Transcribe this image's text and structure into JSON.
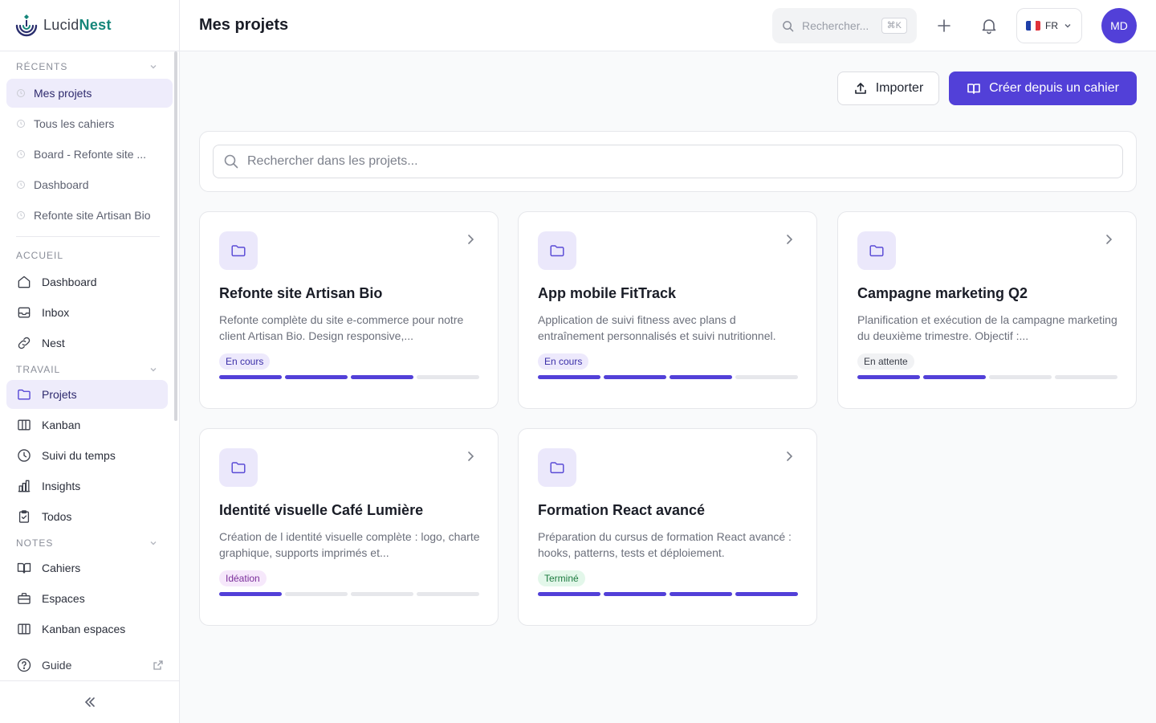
{
  "brand": {
    "name_part1": "Lucid",
    "name_part2": "Nest"
  },
  "header": {
    "title": "Mes projets",
    "search_placeholder": "Rechercher...",
    "search_shortcut": "⌘K",
    "language": "FR",
    "avatar_initials": "MD"
  },
  "sidebar": {
    "recents_title": "Récents",
    "recents": [
      {
        "label": "Mes projets",
        "active": true
      },
      {
        "label": "Tous les cahiers"
      },
      {
        "label": "Board - Refonte site ..."
      },
      {
        "label": "Dashboard"
      },
      {
        "label": "Refonte site Artisan Bio"
      }
    ],
    "accueil_title": "Accueil",
    "accueil": [
      {
        "label": "Dashboard",
        "icon": "home-icon"
      },
      {
        "label": "Inbox",
        "icon": "inbox-icon"
      },
      {
        "label": "Nest",
        "icon": "link-icon"
      }
    ],
    "travail_title": "Travail",
    "travail": [
      {
        "label": "Projets",
        "icon": "folder-icon",
        "active": true
      },
      {
        "label": "Kanban",
        "icon": "kanban-icon"
      },
      {
        "label": "Suivi du temps",
        "icon": "clock-icon"
      },
      {
        "label": "Insights",
        "icon": "chart-icon"
      },
      {
        "label": "Todos",
        "icon": "clipboard-icon"
      }
    ],
    "notes_title": "Notes",
    "notes": [
      {
        "label": "Cahiers",
        "icon": "book-icon"
      },
      {
        "label": "Espaces",
        "icon": "briefcase-icon"
      },
      {
        "label": "Kanban espaces",
        "icon": "kanban-icon"
      }
    ],
    "guide_label": "Guide"
  },
  "actions": {
    "import_label": "Importer",
    "create_label": "Créer depuis un cahier"
  },
  "search": {
    "placeholder": "Rechercher dans les projets..."
  },
  "colors": {
    "accent": "#5240d8",
    "brand_teal": "#15867a"
  },
  "projects": [
    {
      "title": "Refonte site Artisan Bio",
      "description": "Refonte complète du site e-commerce pour notre client Artisan Bio. Design responsive,...",
      "status": "En cours",
      "status_kind": "encours",
      "progress_steps_done": 3,
      "progress_steps_total": 4
    },
    {
      "title": "App mobile FitTrack",
      "description": "Application de suivi fitness avec plans d entraînement personnalisés et suivi nutritionnel.",
      "status": "En cours",
      "status_kind": "encours",
      "progress_steps_done": 3,
      "progress_steps_total": 4
    },
    {
      "title": "Campagne marketing Q2",
      "description": "Planification et exécution de la campagne marketing du deuxième trimestre. Objectif :...",
      "status": "En attente",
      "status_kind": "attente",
      "progress_steps_done": 2,
      "progress_steps_total": 4
    },
    {
      "title": "Identité visuelle Café Lumière",
      "description": "Création de l identité visuelle complète : logo, charte graphique, supports imprimés et...",
      "status": "Idéation",
      "status_kind": "ideation",
      "progress_steps_done": 1,
      "progress_steps_total": 4
    },
    {
      "title": "Formation React avancé",
      "description": "Préparation du cursus de formation React avancé : hooks, patterns, tests et déploiement.",
      "status": "Terminé",
      "status_kind": "termine",
      "progress_steps_done": 4,
      "progress_steps_total": 4
    }
  ]
}
